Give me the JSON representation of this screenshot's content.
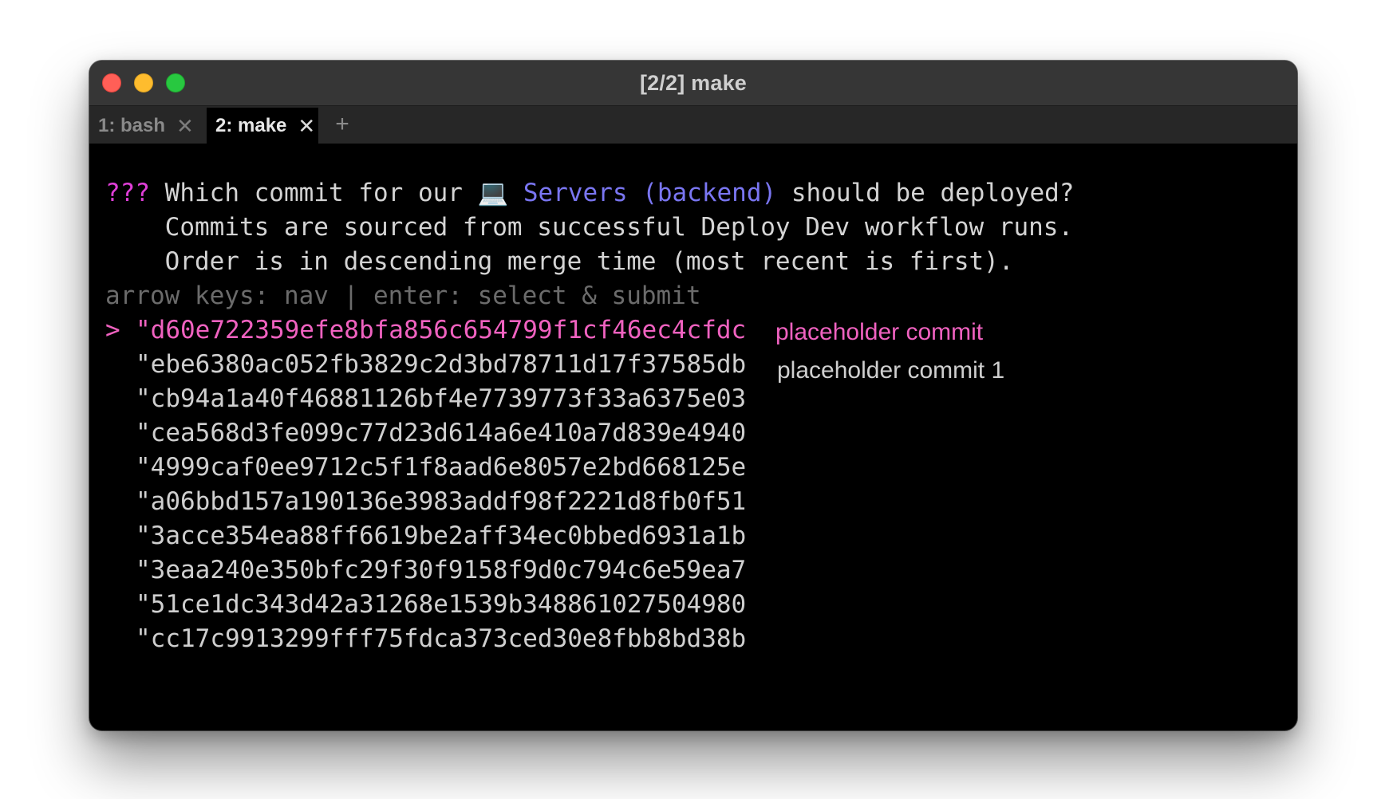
{
  "window": {
    "title": "[2/2] make"
  },
  "tabs": [
    {
      "label": "1: bash",
      "close_glyph": "✕",
      "active": false
    },
    {
      "label": "2: make",
      "close_glyph": "✕",
      "active": true
    }
  ],
  "new_tab_glyph": "+",
  "prompt": {
    "marker": "???",
    "question_before": " Which commit for our ",
    "service_icon": "💻",
    "service_name": " Servers (backend)",
    "question_after": " should be deployed?",
    "detail_lines": [
      "    Commits are sourced from successful Deploy Dev workflow runs.",
      "    Order is in descending merge time (most recent is first)."
    ],
    "hint": "arrow keys: nav | enter: select & submit",
    "cursor": ">"
  },
  "commits": [
    {
      "hash": "\"d60e722359efe8bfa856c654799f1cf46ec4cfdc",
      "selected": true
    },
    {
      "hash": "\"ebe6380ac052fb3829c2d3bd78711d17f37585db",
      "selected": false
    },
    {
      "hash": "\"cb94a1a40f46881126bf4e7739773f33a6375e03",
      "selected": false
    },
    {
      "hash": "\"cea568d3fe099c77d23d614a6e410a7d839e4940",
      "selected": false
    },
    {
      "hash": "\"4999caf0ee9712c5f1f8aad6e8057e2bd668125e",
      "selected": false
    },
    {
      "hash": "\"a06bbd157a190136e3983addf98f2221d8fb0f51",
      "selected": false
    },
    {
      "hash": "\"3acce354ea88ff6619be2aff34ec0bbed6931a1b",
      "selected": false
    },
    {
      "hash": "\"3eaa240e350bfc29f30f9158f9d0c794c6e59ea7",
      "selected": false
    },
    {
      "hash": "\"51ce1dc343d42a31268e1539b348861027504980",
      "selected": false
    },
    {
      "hash": "\"cc17c9913299fff75fdca373ced30e8fbb8bd38b",
      "selected": false
    }
  ],
  "commit_descriptions": [
    "placeholder commit",
    "placeholder commit 1"
  ],
  "colors": {
    "prompt_marker": "#e03fd8",
    "service": "#7a76f2",
    "selection": "#f062c0",
    "hint": "#6b6b6b",
    "text": "#d4d4d4",
    "close": "#ff5f57",
    "minimize": "#febc2e",
    "zoom": "#28c840"
  }
}
